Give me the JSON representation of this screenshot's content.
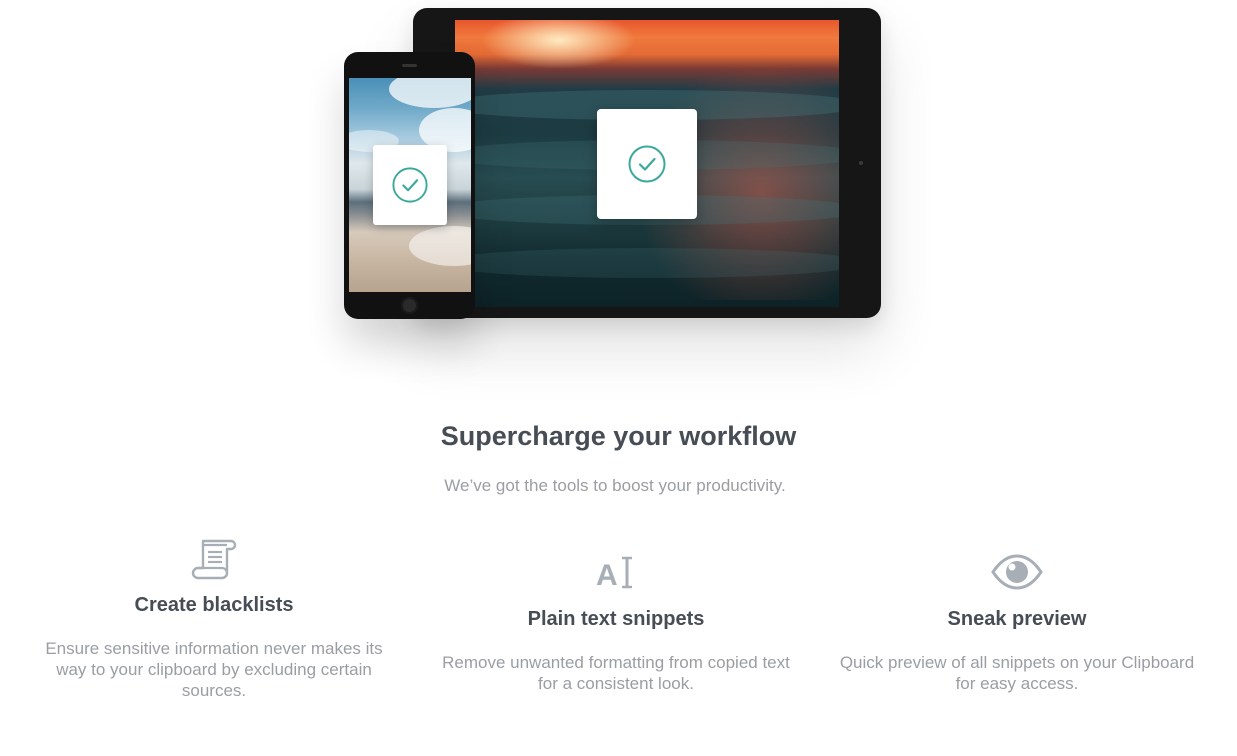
{
  "hero": {
    "tablet_label": "tablet mockup",
    "phone_label": "phone mockup"
  },
  "section": {
    "title": "Supercharge your workflow",
    "subtitle": "We’ve got the tools to boost your productivity."
  },
  "features": [
    {
      "icon": "scroll-document-icon",
      "title": "Create blacklists",
      "description": "Ensure sensitive information never makes its way to your clipboard by excluding certain sources."
    },
    {
      "icon": "text-cursor-icon",
      "icon_text": "A",
      "title": "Plain text snippets",
      "description": "Remove unwanted formatting from copied text for a consistent look."
    },
    {
      "icon": "eye-icon",
      "title": "Sneak preview",
      "description": "Quick preview of all snippets on your Clipboard for easy access."
    }
  ],
  "colors": {
    "heading": "#474d55",
    "body": "#9a9ea3",
    "icon": "#a7aeb5",
    "check": "#3aa99b"
  }
}
